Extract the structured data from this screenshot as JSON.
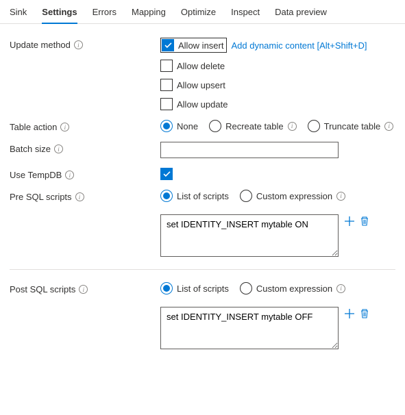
{
  "tabs": {
    "items": [
      "Sink",
      "Settings",
      "Errors",
      "Mapping",
      "Optimize",
      "Inspect",
      "Data preview"
    ],
    "active": "Settings"
  },
  "form": {
    "update_method": {
      "label": "Update method",
      "allow_insert": "Allow insert",
      "allow_delete": "Allow delete",
      "allow_upsert": "Allow upsert",
      "allow_update": "Allow update",
      "dynamic_link": "Add dynamic content [Alt+Shift+D]"
    },
    "table_action": {
      "label": "Table action",
      "none": "None",
      "recreate": "Recreate table",
      "truncate": "Truncate table"
    },
    "batch_size": {
      "label": "Batch size",
      "value": ""
    },
    "use_tempdb": {
      "label": "Use TempDB"
    },
    "pre_sql": {
      "label": "Pre SQL scripts",
      "list_of_scripts": "List of scripts",
      "custom_expression": "Custom expression",
      "value": "set IDENTITY_INSERT mytable ON"
    },
    "post_sql": {
      "label": "Post SQL scripts",
      "list_of_scripts": "List of scripts",
      "custom_expression": "Custom expression",
      "value": "set IDENTITY_INSERT mytable OFF"
    }
  }
}
